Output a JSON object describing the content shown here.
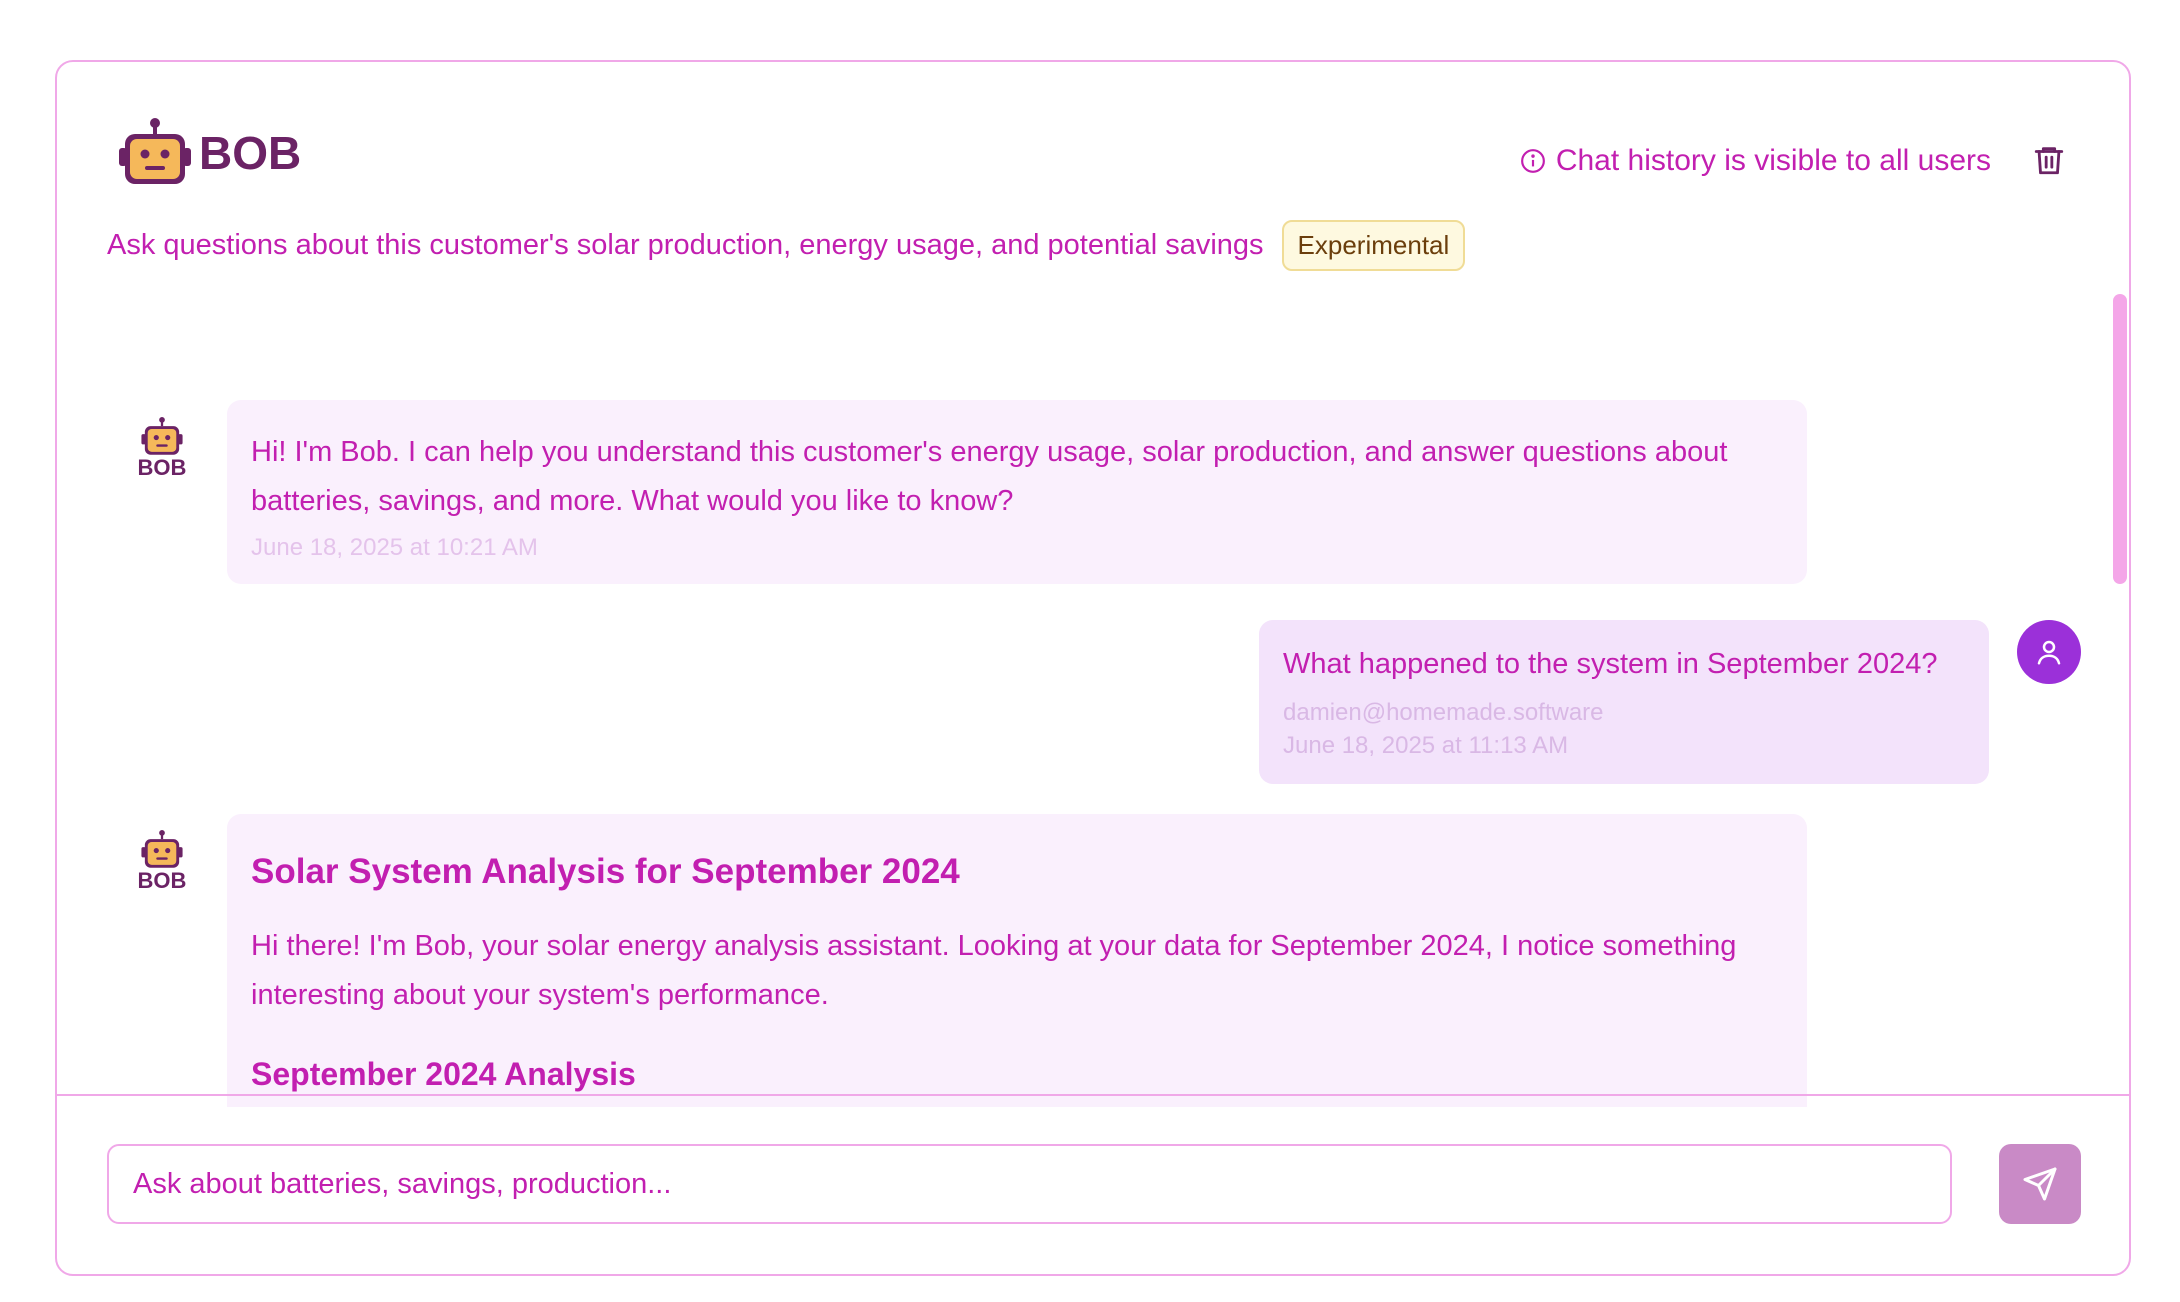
{
  "header": {
    "logo_text": "BOB",
    "history_note": "Chat history is visible to all users",
    "subtitle": "Ask questions about this customer's solar production, energy usage, and potential savings",
    "badge": "Experimental"
  },
  "messages": [
    {
      "role": "bot",
      "avatar_label": "BOB",
      "text": "Hi! I'm Bob. I can help you understand this customer's energy usage, solar production, and answer questions about batteries, savings, and more. What would you like to know?",
      "timestamp": "June 18, 2025 at 10:21 AM"
    },
    {
      "role": "user",
      "text": "What happened to the system in September 2024?",
      "author": "damien@homemade.software",
      "timestamp": "June 18, 2025 at 11:13 AM"
    },
    {
      "role": "bot",
      "avatar_label": "BOB",
      "heading": "Solar System Analysis for September 2024",
      "text": "Hi there! I'm Bob, your solar energy analysis assistant. Looking at your data for September 2024, I notice something interesting about your system's performance.",
      "subheading": "September 2024 Analysis"
    }
  ],
  "composer": {
    "placeholder": "Ask about batteries, savings, production..."
  },
  "colors": {
    "accent": "#c21fb0",
    "border": "#f0a8e8",
    "bot_bubble": "#faf0fd",
    "user_bubble": "#f3e3fb",
    "user_avatar": "#9b30d9",
    "send_button": "#c98ac6",
    "logo": "#6b2365",
    "robot_face": "#f5b85a"
  },
  "icons": {
    "logo": "robot-icon",
    "info": "info-icon",
    "delete": "trash-icon",
    "user": "user-icon",
    "send": "send-icon"
  }
}
